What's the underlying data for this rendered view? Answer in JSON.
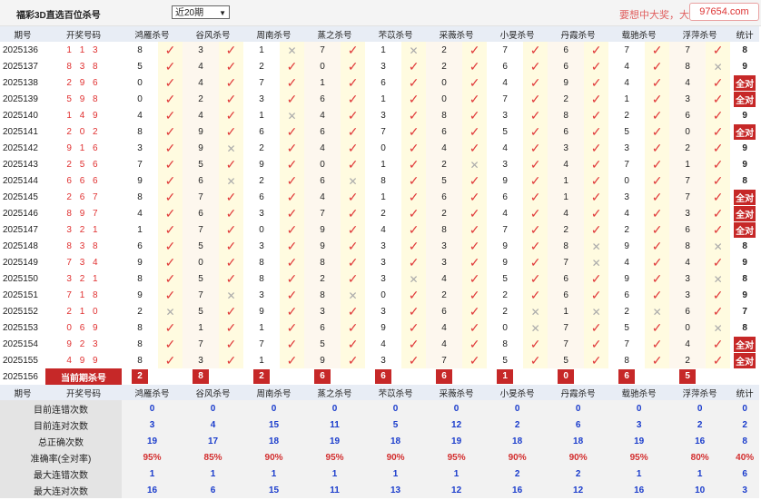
{
  "top": {
    "title": "福彩3D直选百位杀号",
    "period_select": "近20期",
    "promo": "要想中大奖，大",
    "site": "97654.com"
  },
  "columns": [
    "期号",
    "开奖号码",
    "鸿雁杀号",
    "谷风杀号",
    "周南杀号",
    "蒸之杀号",
    "芣苡杀号",
    "采薇杀号",
    "小旻杀号",
    "丹霞杀号",
    "载驰杀号",
    "浮萍杀号",
    "统计"
  ],
  "marks": {
    "ok": "✓",
    "ng": "✕"
  },
  "rows": [
    {
      "issue": "2025136",
      "nums": "1 1 3",
      "k": [
        [
          "8",
          "o"
        ],
        [
          "3",
          "o"
        ],
        [
          "1",
          "x"
        ],
        [
          "7",
          "o"
        ],
        [
          "1",
          "x"
        ],
        [
          "2",
          "o"
        ],
        [
          "7",
          "o"
        ],
        [
          "6",
          "o"
        ],
        [
          "7",
          "o"
        ],
        [
          "7",
          "o"
        ]
      ],
      "stat": "8",
      "all": false
    },
    {
      "issue": "2025137",
      "nums": "8 3 8",
      "k": [
        [
          "5",
          "o"
        ],
        [
          "4",
          "o"
        ],
        [
          "2",
          "o"
        ],
        [
          "0",
          "o"
        ],
        [
          "3",
          "o"
        ],
        [
          "2",
          "o"
        ],
        [
          "6",
          "o"
        ],
        [
          "6",
          "o"
        ],
        [
          "4",
          "o"
        ],
        [
          "8",
          "x"
        ]
      ],
      "stat": "9",
      "all": false
    },
    {
      "issue": "2025138",
      "nums": "2 9 6",
      "k": [
        [
          "0",
          "o"
        ],
        [
          "4",
          "o"
        ],
        [
          "7",
          "o"
        ],
        [
          "1",
          "o"
        ],
        [
          "6",
          "o"
        ],
        [
          "0",
          "o"
        ],
        [
          "4",
          "o"
        ],
        [
          "9",
          "o"
        ],
        [
          "4",
          "o"
        ],
        [
          "4",
          "o"
        ]
      ],
      "stat": "全对",
      "all": true
    },
    {
      "issue": "2025139",
      "nums": "5 9 8",
      "k": [
        [
          "0",
          "o"
        ],
        [
          "2",
          "o"
        ],
        [
          "3",
          "o"
        ],
        [
          "6",
          "o"
        ],
        [
          "1",
          "o"
        ],
        [
          "0",
          "o"
        ],
        [
          "7",
          "o"
        ],
        [
          "2",
          "o"
        ],
        [
          "1",
          "o"
        ],
        [
          "3",
          "o"
        ]
      ],
      "stat": "全对",
      "all": true
    },
    {
      "issue": "2025140",
      "nums": "1 4 9",
      "k": [
        [
          "4",
          "o"
        ],
        [
          "4",
          "o"
        ],
        [
          "1",
          "x"
        ],
        [
          "4",
          "o"
        ],
        [
          "3",
          "o"
        ],
        [
          "8",
          "o"
        ],
        [
          "3",
          "o"
        ],
        [
          "8",
          "o"
        ],
        [
          "2",
          "o"
        ],
        [
          "6",
          "o"
        ]
      ],
      "stat": "9",
      "all": false
    },
    {
      "issue": "2025141",
      "nums": "2 0 2",
      "k": [
        [
          "8",
          "o"
        ],
        [
          "9",
          "o"
        ],
        [
          "6",
          "o"
        ],
        [
          "6",
          "o"
        ],
        [
          "7",
          "o"
        ],
        [
          "6",
          "o"
        ],
        [
          "5",
          "o"
        ],
        [
          "6",
          "o"
        ],
        [
          "5",
          "o"
        ],
        [
          "0",
          "o"
        ]
      ],
      "stat": "全对",
      "all": true
    },
    {
      "issue": "2025142",
      "nums": "9 1 6",
      "k": [
        [
          "3",
          "o"
        ],
        [
          "9",
          "x"
        ],
        [
          "2",
          "o"
        ],
        [
          "4",
          "o"
        ],
        [
          "0",
          "o"
        ],
        [
          "4",
          "o"
        ],
        [
          "4",
          "o"
        ],
        [
          "3",
          "o"
        ],
        [
          "3",
          "o"
        ],
        [
          "2",
          "o"
        ]
      ],
      "stat": "9",
      "all": false
    },
    {
      "issue": "2025143",
      "nums": "2 5 6",
      "k": [
        [
          "7",
          "o"
        ],
        [
          "5",
          "o"
        ],
        [
          "9",
          "o"
        ],
        [
          "0",
          "o"
        ],
        [
          "1",
          "o"
        ],
        [
          "2",
          "x"
        ],
        [
          "3",
          "o"
        ],
        [
          "4",
          "o"
        ],
        [
          "7",
          "o"
        ],
        [
          "1",
          "o"
        ]
      ],
      "stat": "9",
      "all": false
    },
    {
      "issue": "2025144",
      "nums": "6 6 6",
      "k": [
        [
          "9",
          "o"
        ],
        [
          "6",
          "x"
        ],
        [
          "2",
          "o"
        ],
        [
          "6",
          "x"
        ],
        [
          "8",
          "o"
        ],
        [
          "5",
          "o"
        ],
        [
          "9",
          "o"
        ],
        [
          "1",
          "o"
        ],
        [
          "0",
          "o"
        ],
        [
          "7",
          "o"
        ]
      ],
      "stat": "8",
      "all": false
    },
    {
      "issue": "2025145",
      "nums": "2 6 7",
      "k": [
        [
          "8",
          "o"
        ],
        [
          "7",
          "o"
        ],
        [
          "6",
          "o"
        ],
        [
          "4",
          "o"
        ],
        [
          "1",
          "o"
        ],
        [
          "6",
          "o"
        ],
        [
          "6",
          "o"
        ],
        [
          "1",
          "o"
        ],
        [
          "3",
          "o"
        ],
        [
          "7",
          "o"
        ]
      ],
      "stat": "全对",
      "all": true
    },
    {
      "issue": "2025146",
      "nums": "8 9 7",
      "k": [
        [
          "4",
          "o"
        ],
        [
          "6",
          "o"
        ],
        [
          "3",
          "o"
        ],
        [
          "7",
          "o"
        ],
        [
          "2",
          "o"
        ],
        [
          "2",
          "o"
        ],
        [
          "4",
          "o"
        ],
        [
          "4",
          "o"
        ],
        [
          "4",
          "o"
        ],
        [
          "3",
          "o"
        ]
      ],
      "stat": "全对",
      "all": true
    },
    {
      "issue": "2025147",
      "nums": "3 2 1",
      "k": [
        [
          "1",
          "o"
        ],
        [
          "7",
          "o"
        ],
        [
          "0",
          "o"
        ],
        [
          "9",
          "o"
        ],
        [
          "4",
          "o"
        ],
        [
          "8",
          "o"
        ],
        [
          "7",
          "o"
        ],
        [
          "2",
          "o"
        ],
        [
          "2",
          "o"
        ],
        [
          "6",
          "o"
        ]
      ],
      "stat": "全对",
      "all": true
    },
    {
      "issue": "2025148",
      "nums": "8 3 8",
      "k": [
        [
          "6",
          "o"
        ],
        [
          "5",
          "o"
        ],
        [
          "3",
          "o"
        ],
        [
          "9",
          "o"
        ],
        [
          "3",
          "o"
        ],
        [
          "3",
          "o"
        ],
        [
          "9",
          "o"
        ],
        [
          "8",
          "x"
        ],
        [
          "9",
          "o"
        ],
        [
          "8",
          "x"
        ]
      ],
      "stat": "8",
      "all": false
    },
    {
      "issue": "2025149",
      "nums": "7 3 4",
      "k": [
        [
          "9",
          "o"
        ],
        [
          "0",
          "o"
        ],
        [
          "8",
          "o"
        ],
        [
          "8",
          "o"
        ],
        [
          "3",
          "o"
        ],
        [
          "3",
          "o"
        ],
        [
          "9",
          "o"
        ],
        [
          "7",
          "x"
        ],
        [
          "4",
          "o"
        ],
        [
          "4",
          "o"
        ]
      ],
      "stat": "9",
      "all": false
    },
    {
      "issue": "2025150",
      "nums": "3 2 1",
      "k": [
        [
          "8",
          "o"
        ],
        [
          "5",
          "o"
        ],
        [
          "8",
          "o"
        ],
        [
          "2",
          "o"
        ],
        [
          "3",
          "x"
        ],
        [
          "4",
          "o"
        ],
        [
          "5",
          "o"
        ],
        [
          "6",
          "o"
        ],
        [
          "9",
          "o"
        ],
        [
          "3",
          "x"
        ]
      ],
      "stat": "8",
      "all": false
    },
    {
      "issue": "2025151",
      "nums": "7 1 8",
      "k": [
        [
          "9",
          "o"
        ],
        [
          "7",
          "x"
        ],
        [
          "3",
          "o"
        ],
        [
          "8",
          "x"
        ],
        [
          "0",
          "o"
        ],
        [
          "2",
          "o"
        ],
        [
          "2",
          "o"
        ],
        [
          "6",
          "o"
        ],
        [
          "6",
          "o"
        ],
        [
          "3",
          "o"
        ]
      ],
      "stat": "9",
      "all": false
    },
    {
      "issue": "2025152",
      "nums": "2 1 0",
      "k": [
        [
          "2",
          "x"
        ],
        [
          "5",
          "o"
        ],
        [
          "9",
          "o"
        ],
        [
          "3",
          "o"
        ],
        [
          "3",
          "o"
        ],
        [
          "6",
          "o"
        ],
        [
          "2",
          "x"
        ],
        [
          "1",
          "x"
        ],
        [
          "2",
          "x"
        ],
        [
          "6",
          "o"
        ]
      ],
      "stat": "7",
      "all": false
    },
    {
      "issue": "2025153",
      "nums": "0 6 9",
      "k": [
        [
          "8",
          "o"
        ],
        [
          "1",
          "o"
        ],
        [
          "1",
          "o"
        ],
        [
          "6",
          "o"
        ],
        [
          "9",
          "o"
        ],
        [
          "4",
          "o"
        ],
        [
          "0",
          "x"
        ],
        [
          "7",
          "o"
        ],
        [
          "5",
          "o"
        ],
        [
          "0",
          "x"
        ]
      ],
      "stat": "8",
      "all": false
    },
    {
      "issue": "2025154",
      "nums": "9 2 3",
      "k": [
        [
          "8",
          "o"
        ],
        [
          "7",
          "o"
        ],
        [
          "7",
          "o"
        ],
        [
          "5",
          "o"
        ],
        [
          "4",
          "o"
        ],
        [
          "4",
          "o"
        ],
        [
          "8",
          "o"
        ],
        [
          "7",
          "o"
        ],
        [
          "7",
          "o"
        ],
        [
          "4",
          "o"
        ]
      ],
      "stat": "全对",
      "all": true
    },
    {
      "issue": "2025155",
      "nums": "4 9 9",
      "k": [
        [
          "8",
          "o"
        ],
        [
          "3",
          "o"
        ],
        [
          "1",
          "o"
        ],
        [
          "9",
          "o"
        ],
        [
          "3",
          "o"
        ],
        [
          "7",
          "o"
        ],
        [
          "5",
          "o"
        ],
        [
          "5",
          "o"
        ],
        [
          "8",
          "o"
        ],
        [
          "2",
          "o"
        ]
      ],
      "stat": "全对",
      "all": true
    }
  ],
  "current": {
    "issue": "2025156",
    "label": "当前期杀号",
    "values": [
      "2",
      "8",
      "2",
      "6",
      "6",
      "6",
      "1",
      "0",
      "6",
      "5"
    ]
  },
  "stats": [
    {
      "label": "目前连错次数",
      "values": [
        "0",
        "0",
        "0",
        "0",
        "0",
        "0",
        "0",
        "0",
        "0",
        "0"
      ],
      "total": "0",
      "total_style": "bl"
    },
    {
      "label": "目前连对次数",
      "values": [
        "3",
        "4",
        "15",
        "11",
        "5",
        "12",
        "2",
        "6",
        "3",
        "2"
      ],
      "total": "2",
      "total_style": "bl"
    },
    {
      "label": "总正确次数",
      "values": [
        "19",
        "17",
        "18",
        "19",
        "18",
        "19",
        "18",
        "18",
        "19",
        "16"
      ],
      "total": "8",
      "total_style": "bl"
    },
    {
      "label": "准确率(全对率)",
      "values": [
        "95%",
        "85%",
        "90%",
        "95%",
        "90%",
        "95%",
        "90%",
        "90%",
        "95%",
        "80%"
      ],
      "total": "40%",
      "total_style": "rd",
      "rate": true
    },
    {
      "label": "最大连错次数",
      "values": [
        "1",
        "1",
        "1",
        "1",
        "1",
        "1",
        "2",
        "2",
        "1",
        "1"
      ],
      "total": "6",
      "total_style": "bl"
    },
    {
      "label": "最大连对次数",
      "values": [
        "16",
        "6",
        "15",
        "11",
        "13",
        "12",
        "16",
        "12",
        "16",
        "10"
      ],
      "total": "3",
      "total_style": "bl"
    }
  ],
  "colors": {
    "accent": "#c62828",
    "check": "#e03a3a",
    "cross": "#aaaaaa",
    "blue": "#1a3ccc"
  }
}
